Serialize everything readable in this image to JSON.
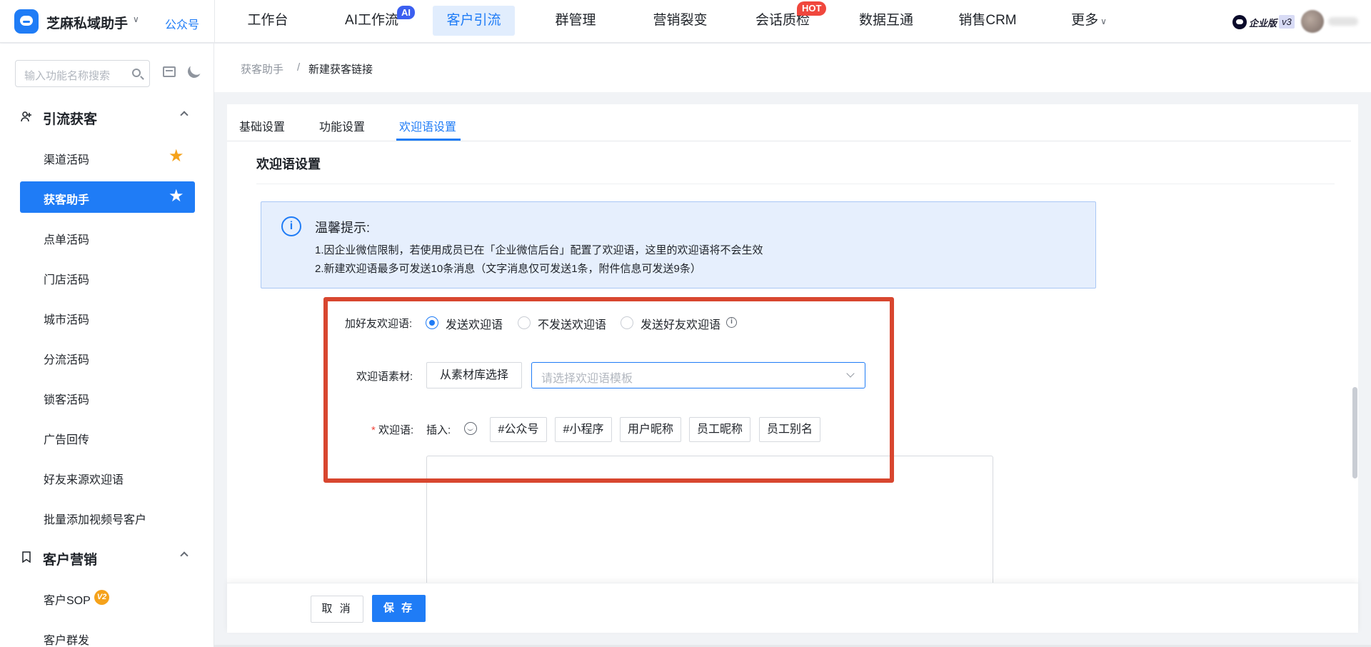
{
  "header": {
    "app_name": "芝麻私域助手",
    "gzh_link": "公众号",
    "nav": [
      {
        "label": "工作台"
      },
      {
        "label": "AI工作流",
        "badge": "AI"
      },
      {
        "label": "客户引流",
        "active": true
      },
      {
        "label": "群管理"
      },
      {
        "label": "营销裂变"
      },
      {
        "label": "会话质检",
        "badge": "HOT"
      },
      {
        "label": "数据互通"
      },
      {
        "label": "销售CRM"
      },
      {
        "label": "更多"
      }
    ],
    "edition": "企业版",
    "version": "v3"
  },
  "sidebar": {
    "search_placeholder": "输入功能名称搜索",
    "groups": [
      {
        "title": "引流获客",
        "icon": "user-add-icon",
        "items": [
          {
            "label": "渠道活码",
            "starred": true
          },
          {
            "label": "获客助手",
            "active": true,
            "starred": true
          },
          {
            "label": "点单活码"
          },
          {
            "label": "门店活码"
          },
          {
            "label": "城市活码"
          },
          {
            "label": "分流活码"
          },
          {
            "label": "锁客活码"
          },
          {
            "label": "广告回传"
          },
          {
            "label": "好友来源欢迎语"
          },
          {
            "label": "批量添加视频号客户"
          }
        ]
      },
      {
        "title": "客户营销",
        "icon": "bookmark-icon",
        "items": [
          {
            "label": "客户SOP",
            "badge": "V2"
          },
          {
            "label": "客户群发"
          }
        ]
      }
    ]
  },
  "breadcrumb": {
    "parent": "获客助手",
    "separator": "/",
    "current": "新建获客链接"
  },
  "tabs": [
    {
      "label": "基础设置"
    },
    {
      "label": "功能设置"
    },
    {
      "label": "欢迎语设置",
      "active": true
    }
  ],
  "section_title": "欢迎语设置",
  "notice": {
    "title": "温馨提示:",
    "line1": "1.因企业微信限制，若使用成员已在「企业微信后台」配置了欢迎语，这里的欢迎语将不会生效",
    "line2": "2.新建欢迎语最多可发送10条消息（文字消息仅可发送1条，附件信息可发送9条）"
  },
  "form": {
    "add_friend_label": "加好友欢迎语:",
    "radio_options": [
      {
        "label": "发送欢迎语",
        "checked": true
      },
      {
        "label": "不发送欢迎语",
        "checked": false
      },
      {
        "label": "发送好友欢迎语",
        "checked": false
      }
    ],
    "material_label": "欢迎语素材:",
    "material_button": "从素材库选择",
    "template_placeholder": "请选择欢迎语模板",
    "welcome_label_star": "*",
    "welcome_label": "欢迎语:",
    "insert_label": "插入:",
    "insert_tags": [
      "#公众号",
      "#小程序",
      "用户昵称",
      "员工昵称",
      "员工别名"
    ],
    "textarea_value": ""
  },
  "footer": {
    "cancel": "取 消",
    "save": "保 存"
  },
  "colors": {
    "primary": "#1f7cf6",
    "highlight_box": "#d8462f",
    "hot_badge": "#f0473d",
    "star": "#f5a21b"
  }
}
